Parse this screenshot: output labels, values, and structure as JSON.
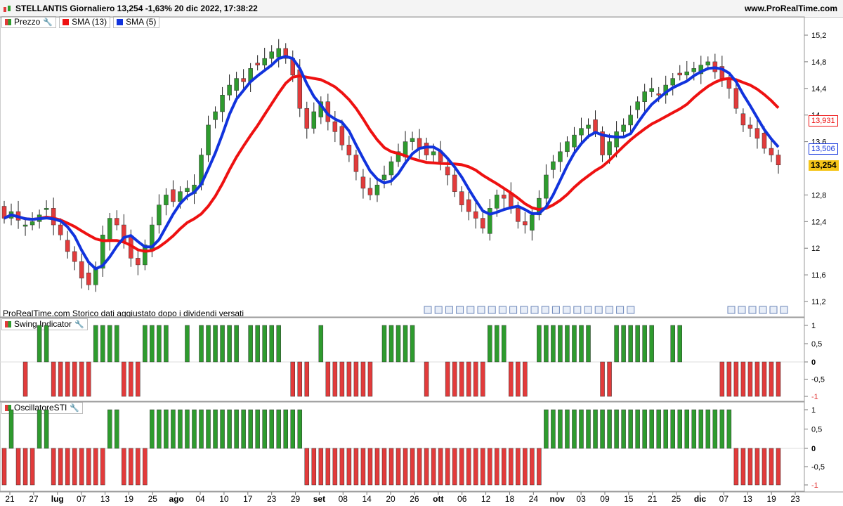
{
  "header": {
    "title": "STELLANTIS Giornaliero 13,254 -1,63% 20 dic 2022, 17:38:22",
    "site": "www.ProRealTime.com"
  },
  "price_panel": {
    "legend": [
      "Prezzo",
      "SMA (13)",
      "SMA (5)"
    ],
    "note": "ProRealTime.com  Storico dati aggiustato dopo i dividendi versati",
    "y_ticks": [
      "15,2",
      "14,8",
      "14,4",
      "14",
      "13,6",
      "12,8",
      "12,4",
      "12",
      "11,6",
      "11,2"
    ],
    "badges": {
      "sma13": "13,931",
      "sma5": "13,506",
      "last": "13,254"
    }
  },
  "swing_panel": {
    "legend": "Swing Indicator",
    "y_ticks": [
      "1",
      "0,5",
      "0",
      "-0,5",
      "-1"
    ]
  },
  "sti_panel": {
    "legend": "OscillatoreSTI",
    "y_ticks": [
      "1",
      "0,5",
      "0",
      "-0,5",
      "-1"
    ]
  },
  "x_axis": {
    "labels": [
      "21",
      "27",
      "lug",
      "07",
      "13",
      "19",
      "25",
      "ago",
      "04",
      "10",
      "17",
      "23",
      "29",
      "set",
      "08",
      "14",
      "20",
      "26",
      "ott",
      "06",
      "12",
      "18",
      "24",
      "nov",
      "03",
      "09",
      "15",
      "21",
      "25",
      "dic",
      "07",
      "13",
      "19",
      "23"
    ],
    "bold": [
      "lug",
      "ago",
      "set",
      "ott",
      "nov",
      "dic"
    ]
  },
  "colors": {
    "up": "#2e9b2e",
    "down": "#e23b3b",
    "sma13": "#ee1111",
    "sma5": "#1133dd",
    "axis_badge_last": "#f5c518"
  },
  "chart_data": {
    "type": "candlestick",
    "series_close": [
      12.45,
      12.55,
      12.42,
      12.35,
      12.4,
      12.5,
      12.6,
      12.35,
      12.2,
      11.95,
      11.8,
      11.55,
      11.45,
      11.7,
      12.2,
      12.45,
      12.35,
      12.1,
      11.85,
      11.75,
      12.05,
      12.35,
      12.65,
      12.8,
      12.7,
      12.85,
      12.9,
      12.95,
      13.4,
      13.85,
      14.05,
      14.3,
      14.45,
      14.55,
      14.5,
      14.7,
      14.75,
      14.85,
      14.95,
      15.0,
      14.85,
      14.6,
      14.1,
      13.8,
      14.05,
      14.2,
      13.9,
      13.75,
      13.55,
      13.4,
      13.15,
      12.9,
      12.8,
      12.95,
      13.1,
      13.3,
      13.45,
      13.6,
      13.65,
      13.5,
      13.4,
      13.45,
      13.3,
      13.1,
      12.85,
      12.65,
      12.55,
      12.45,
      12.3,
      12.6,
      12.8,
      12.75,
      12.6,
      12.4,
      12.35,
      12.5,
      12.75,
      13.1,
      13.3,
      13.45,
      13.6,
      13.7,
      13.8,
      13.85,
      13.75,
      13.4,
      13.6,
      13.75,
      13.85,
      14.0,
      14.2,
      14.35,
      14.4,
      14.3,
      14.45,
      14.55,
      14.6,
      14.65,
      14.7,
      14.75,
      14.8,
      14.65,
      14.55,
      14.4,
      14.1,
      13.85,
      13.8,
      13.65,
      13.5,
      13.4,
      13.25
    ],
    "sma13_last": 13.931,
    "sma5_last": 13.506,
    "last": 13.254,
    "ylim": [
      11.0,
      15.4
    ]
  }
}
